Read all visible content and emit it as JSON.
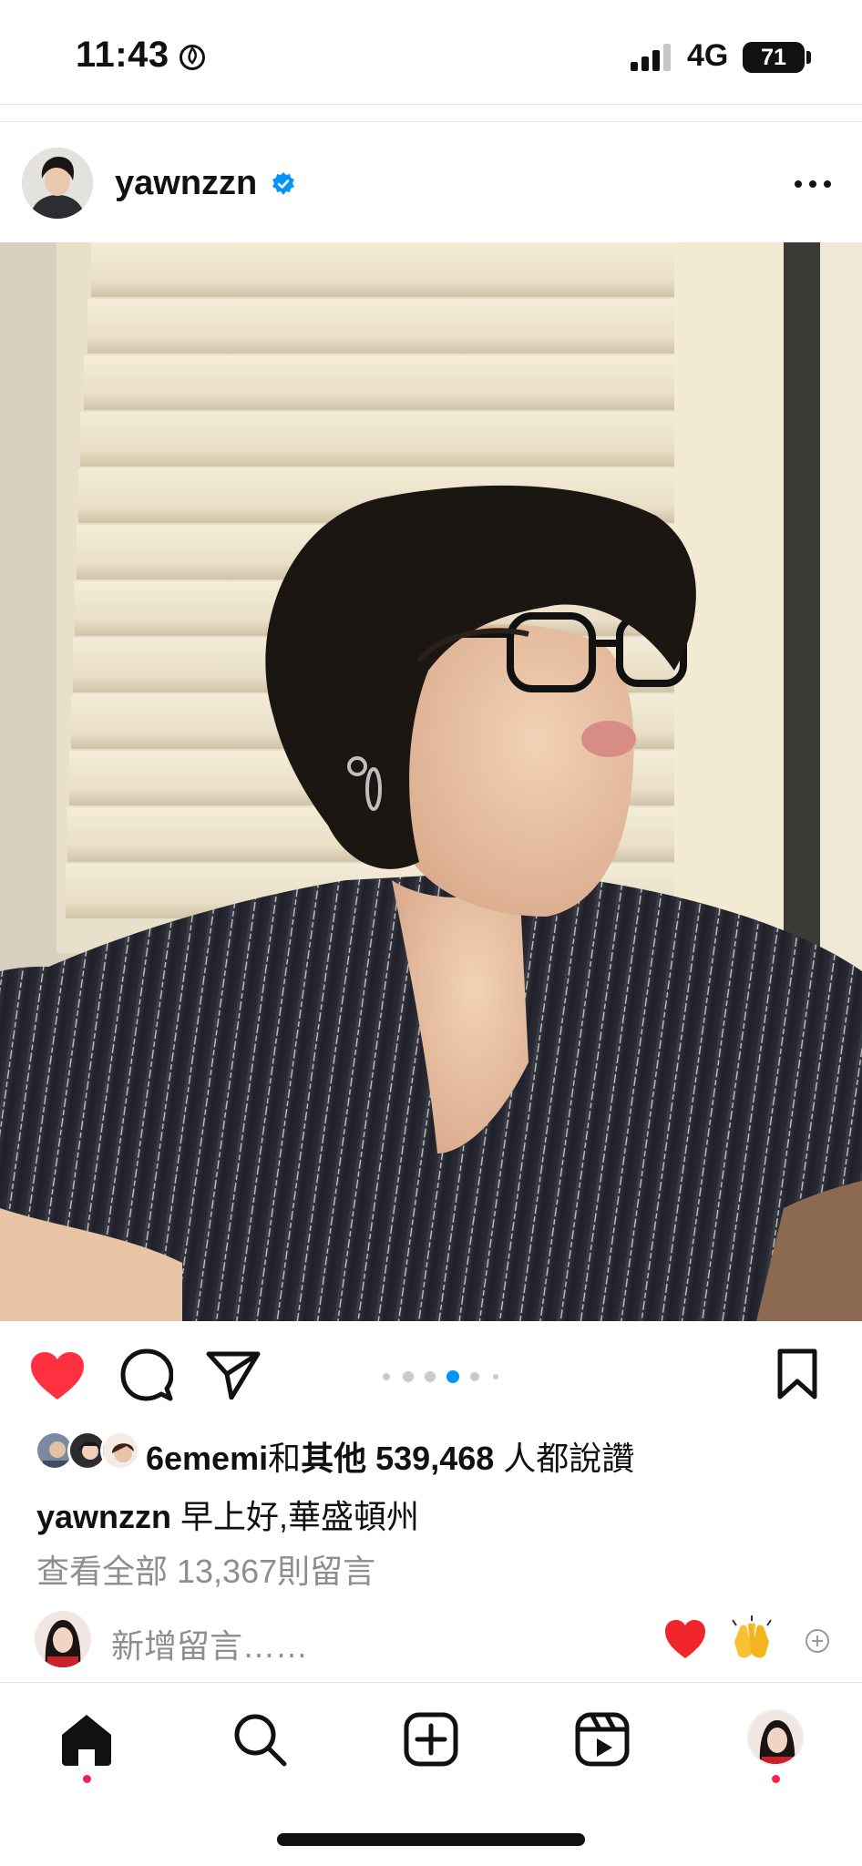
{
  "status_bar": {
    "time": "11:43",
    "network": "4G",
    "battery": "71"
  },
  "post": {
    "username": "yawnzzn",
    "verified": true,
    "carousel": {
      "count": 6,
      "active_index": 3
    },
    "likes": {
      "first_liker": "6ememi",
      "connector": "和",
      "others_label": "其他",
      "count": "539,468",
      "suffix": "人都說讚"
    },
    "caption": {
      "username": "yawnzzn",
      "text": "早上好,華盛頓州"
    },
    "view_comments": "查看全部 13,367則留言",
    "add_comment": {
      "placeholder": "新增留言……",
      "quick_reactions": [
        "❤️",
        "🙌"
      ]
    }
  },
  "tabbar": {
    "items": [
      "home-icon",
      "search-icon",
      "create-icon",
      "reels-icon",
      "profile-avatar"
    ],
    "active": "home-icon"
  },
  "colors": {
    "like_red": "#ff3040",
    "verified_blue": "#0095f6",
    "dot_active": "#0095f6",
    "muted_text": "#8e8e8e"
  }
}
